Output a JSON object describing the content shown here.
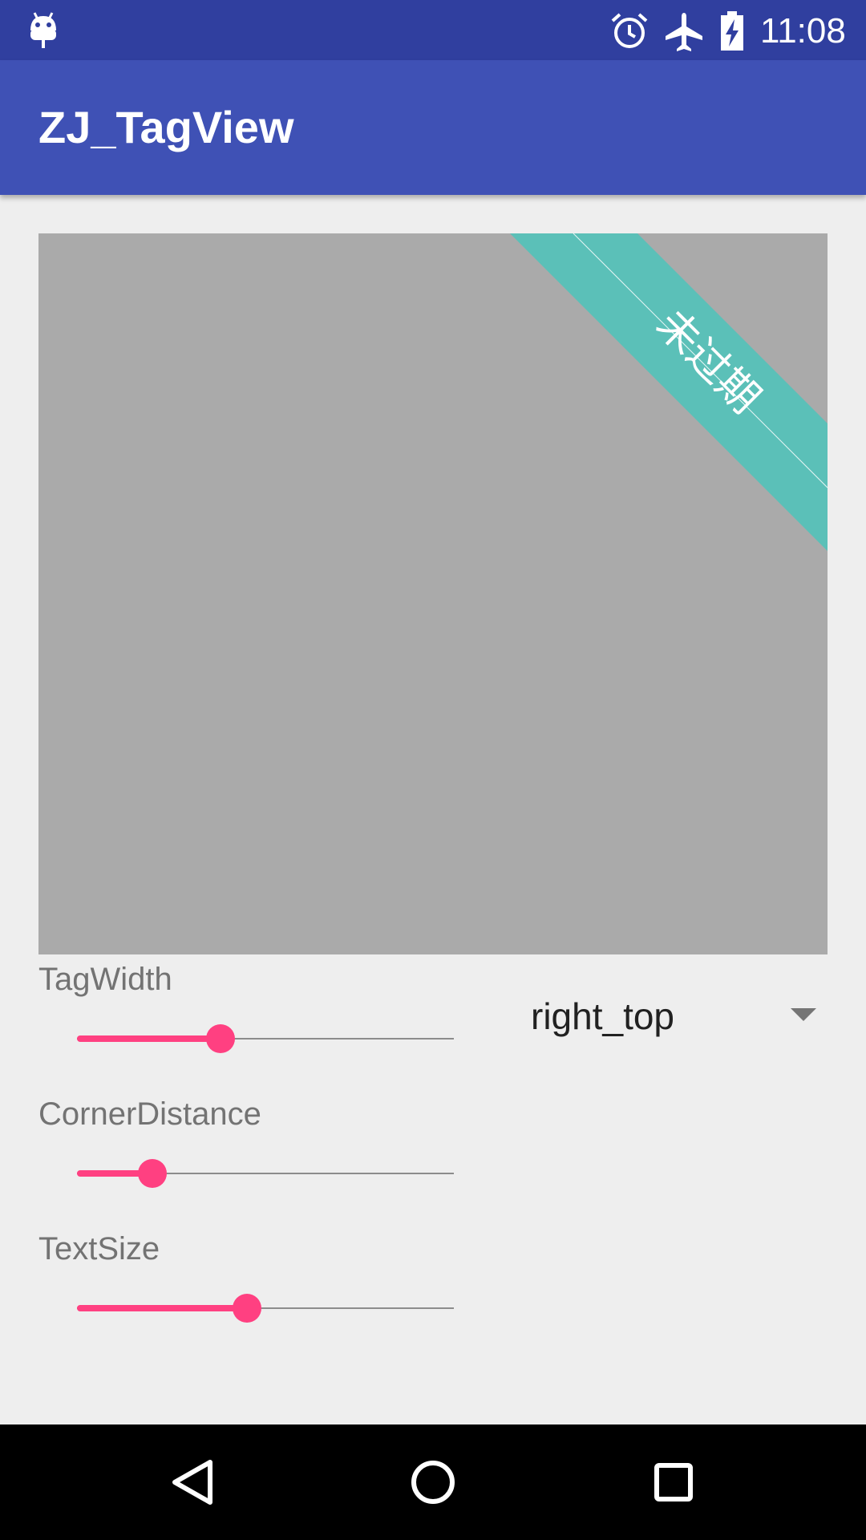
{
  "status_bar": {
    "time": "11:08",
    "icons": [
      "android-icon",
      "alarm-icon",
      "airplane-mode-icon",
      "battery-charging-icon"
    ]
  },
  "app_bar": {
    "title": "ZJ_TagView"
  },
  "tag_view": {
    "tag_text": "未过期",
    "image_color": "#aaaaaa",
    "tag_color": "#5bc0b8"
  },
  "controls": {
    "tag_width": {
      "label": "TagWidth",
      "progress": 0.38
    },
    "corner_distance": {
      "label": "CornerDistance",
      "progress": 0.2
    },
    "text_size": {
      "label": "TextSize",
      "progress": 0.45
    },
    "position_spinner": {
      "selected": "right_top"
    }
  },
  "colors": {
    "primary": "#3f51b5",
    "primary_dark": "#303f9f",
    "accent": "#ff4081",
    "background": "#eeeeee"
  },
  "nav_bar": {
    "icons": [
      "back-icon",
      "home-icon",
      "recents-icon"
    ]
  }
}
